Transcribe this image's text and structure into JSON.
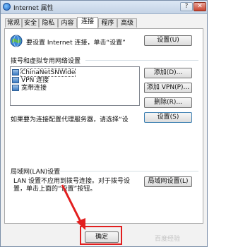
{
  "window": {
    "title": "Internet 属性",
    "help_glyph": "?",
    "close_glyph": "✕"
  },
  "tabs": [
    {
      "label": "常规",
      "active": false
    },
    {
      "label": "安全",
      "active": false
    },
    {
      "label": "隐私",
      "active": false
    },
    {
      "label": "内容",
      "active": false
    },
    {
      "label": "连接",
      "active": true
    },
    {
      "label": "程序",
      "active": false
    },
    {
      "label": "高级",
      "active": false
    }
  ],
  "connection": {
    "setup_text": "要设置 Internet 连接，单击“设置”",
    "setup_button": "设置(U)",
    "dialup_group_label": "拨号和虚拟专用网络设置",
    "dialup_items": [
      {
        "label": "ChinaNetSNWide",
        "selected": true
      },
      {
        "label": "VPN 连接",
        "selected": false
      },
      {
        "label": "宽带连接",
        "selected": false
      }
    ],
    "add_button": "添加(D)...",
    "add_vpn_button": "添加 VPN(P)...",
    "remove_button": "删除(R)...",
    "proxy_text": "如果要为连接配置代理服务器，请选择“设",
    "settings_button": "设置(S)",
    "lan_group_label": "局域网(LAN)设置",
    "lan_text_line1": "LAN 设置不应用到拨号连接。对于拨号设",
    "lan_text_line2": "置，单击上面的“设置”按钮。",
    "lan_button": "局域网设置(L)"
  },
  "footer": {
    "ok_button": "确定",
    "watermark": "百度经验"
  },
  "colors": {
    "highlight": "#e21f1f",
    "window_bg": "#f2f2f2",
    "panel_bg": "#ffffff"
  }
}
